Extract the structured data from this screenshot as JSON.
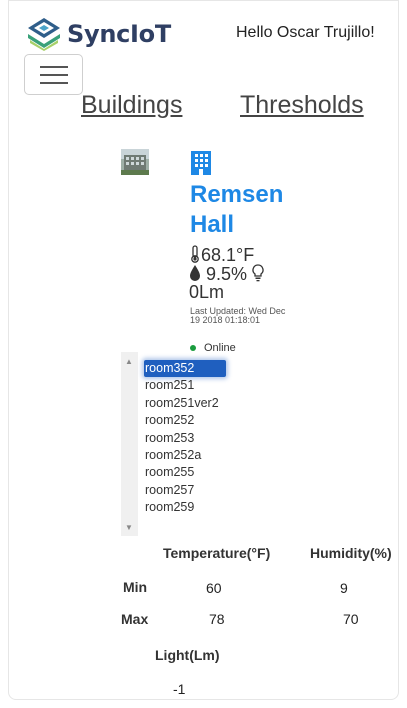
{
  "header": {
    "brand": "SyncIoT",
    "greeting": "Hello Oscar Trujillo!"
  },
  "nav": {
    "buildings": "Buildings",
    "thresholds": "Thresholds"
  },
  "building": {
    "name": "Remsen Hall",
    "temperature": "68.1°F",
    "humidity": "9.5%",
    "light": "0Lm",
    "last_updated": "Last Updated: Wed Dec 19 2018 01:18:01",
    "status": "Online"
  },
  "rooms": {
    "selected": "room352",
    "items": [
      "room352",
      "room251",
      "room251ver2",
      "room252",
      "room253",
      "room252a",
      "room255",
      "room257",
      "room259"
    ]
  },
  "thresholds": {
    "temperature_header": "Temperature(°F)",
    "humidity_header": "Humidity(%)",
    "light_header": "Light(Lm)",
    "min_label": "Min",
    "max_label": "Max",
    "temp_min": "60",
    "temp_max": "78",
    "hum_min": "9",
    "hum_max": "70",
    "light_value": "-1"
  },
  "colors": {
    "brand": "#2f3f63",
    "accent": "#1e88e5",
    "online": "#1a9c3e"
  }
}
